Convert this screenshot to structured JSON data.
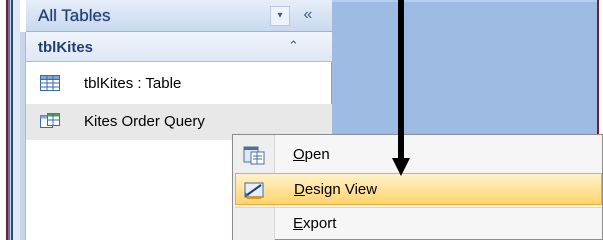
{
  "nav": {
    "header_title": "All Tables",
    "dropdown_glyph": "▾",
    "collapse_glyph": "«",
    "group": {
      "title": "tblKites",
      "toggle_glyph": "⌃"
    },
    "items": [
      {
        "label": "tblKites : Table",
        "icon": "table-icon"
      },
      {
        "label": "Kites Order Query",
        "icon": "query-icon",
        "selected": true
      }
    ]
  },
  "context_menu": {
    "items": [
      {
        "label": "Open",
        "accel": "O",
        "icon": "open-icon"
      },
      {
        "label": "Design View",
        "accel": "D",
        "icon": "design-view-icon",
        "highlighted": true
      },
      {
        "label": "Export",
        "accel": "E",
        "icon": ""
      }
    ]
  },
  "colors": {
    "frame_border": "#7a1c2e",
    "right_pane": "#9ebbe3",
    "highlight": "#ffd36b",
    "nav_text": "#1f3f74"
  }
}
